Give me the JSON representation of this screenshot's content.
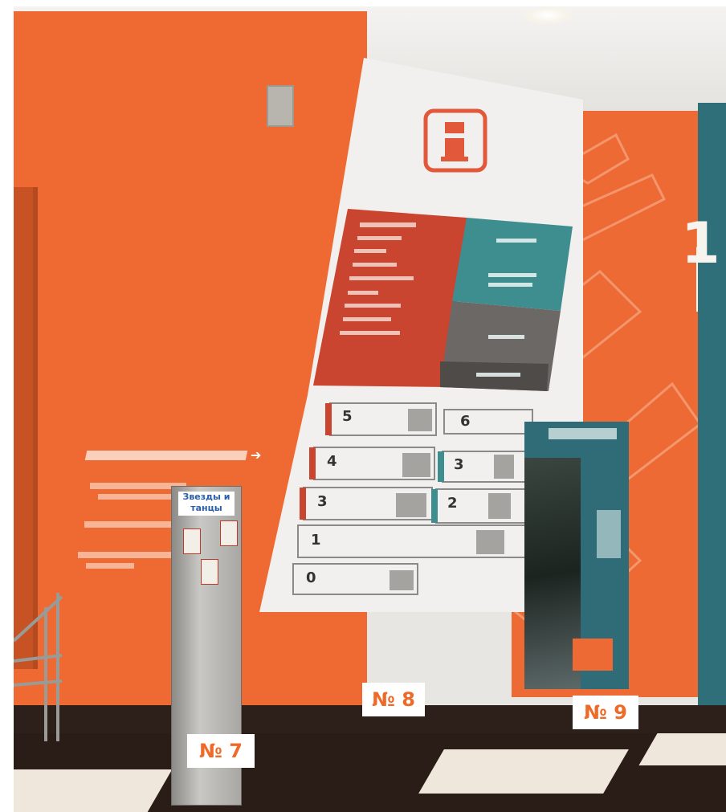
{
  "labels": {
    "label_7": "№ 7",
    "label_8": "№ 8",
    "label_9": "№ 9"
  },
  "board": {
    "logo_icon": "info-icon",
    "floors_upper": [
      "5",
      "6",
      "4",
      "3",
      "3",
      "2",
      "1",
      "0"
    ],
    "big_numeral": "1"
  },
  "totem": {
    "logo_text": "Звезды и танцы"
  },
  "colors": {
    "wall_orange": "#ef6a33",
    "board_red": "#c9452f",
    "board_teal": "#3e8e90",
    "board_gray": "#6c6866",
    "label_text": "#ee6a28"
  }
}
